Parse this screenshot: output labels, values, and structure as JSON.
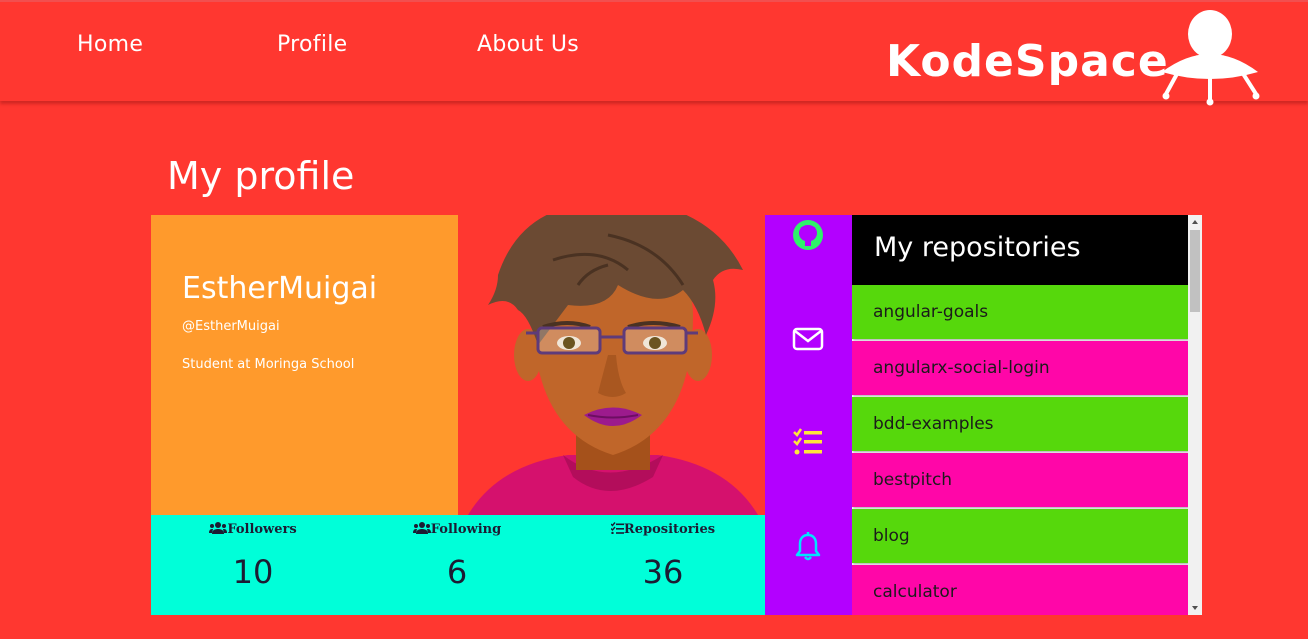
{
  "nav": {
    "home": "Home",
    "profile": "Profile",
    "about": "About Us",
    "brand": "KodeSpace"
  },
  "page": {
    "title": "My profile"
  },
  "profile": {
    "name": "EstherMuigai",
    "handle": "@EstherMuigai",
    "bio": "Student at Moringa School"
  },
  "stats": {
    "followers": {
      "label": "Followers",
      "value": "10",
      "icon": "users-icon"
    },
    "following": {
      "label": "Following",
      "value": "6",
      "icon": "users-icon"
    },
    "repositories": {
      "label": "Repositories",
      "value": "36",
      "icon": "tasks-icon"
    }
  },
  "sidebar_icons": [
    "github-icon",
    "envelope-icon",
    "tasks-icon",
    "bell-icon"
  ],
  "repos": {
    "title": "My repositories",
    "items": [
      "angular-goals",
      "angularx-social-login",
      "bdd-examples",
      "bestpitch",
      "blog",
      "calculator"
    ]
  },
  "colors": {
    "background": "#ff3730",
    "profile_card": "#ff9a2c",
    "stats_bar": "#00ffd9",
    "icon_strip": "#b300ff",
    "repo_green": "#56d80c",
    "repo_pink": "#ff06a8"
  }
}
